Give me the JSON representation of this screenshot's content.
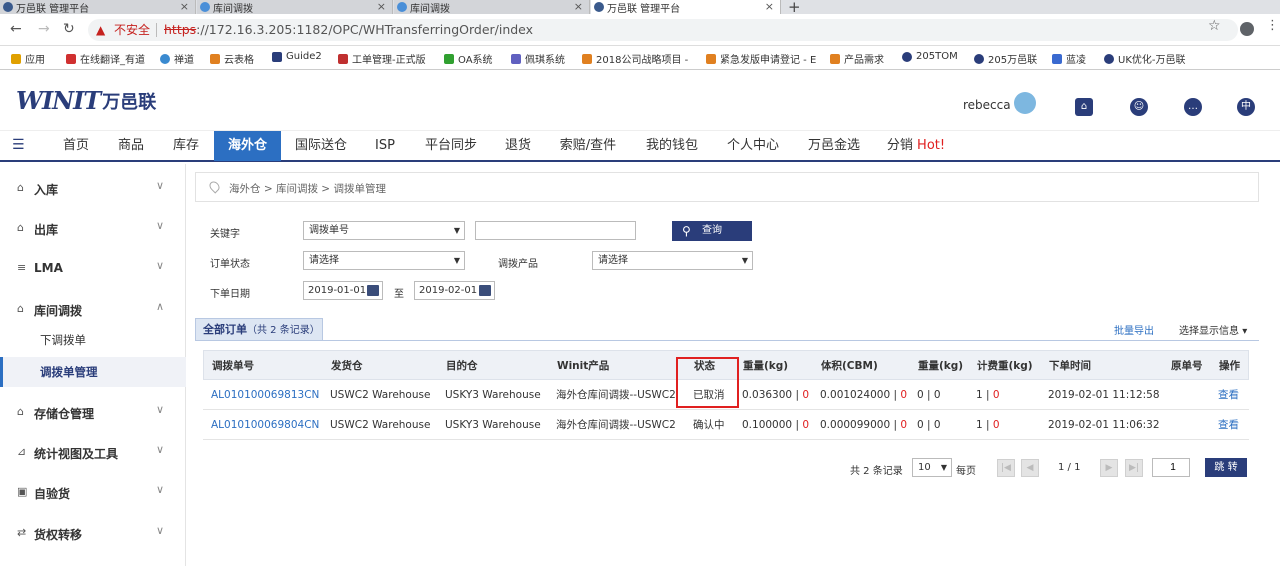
{
  "browser": {
    "tabs": [
      {
        "label": "万邑联 管理平台",
        "active": false
      },
      {
        "label": "库间调拨",
        "active": false
      },
      {
        "label": "库间调拨",
        "active": false
      },
      {
        "label": "万邑联 管理平台",
        "active": true
      }
    ],
    "insecure_label": "不安全",
    "url_scheme": "https",
    "url_rest": "://172.16.3.205:1182/OPC/WHTransferringOrder/index",
    "bookmarks": [
      "应用",
      "在线翻译_有道",
      "禅道",
      "云表格",
      "Guide2",
      "工单管理-正式版",
      "OA系统",
      "佩琪系统",
      "2018公司战略项目 -",
      "紧急发版申请登记 - E",
      "产品需求",
      "205TOM",
      "205万邑联",
      "蓝凌",
      "UK优化-万邑联"
    ]
  },
  "header": {
    "logo_mark": "WINIT",
    "logo_text": "万邑联",
    "username": "rebecca",
    "lang": "中"
  },
  "nav": {
    "items": [
      "首页",
      "商品",
      "库存",
      "海外仓",
      "国际送仓",
      "ISP",
      "平台同步",
      "退货",
      "索赔/查件",
      "我的钱包",
      "个人中心",
      "万邑金选",
      "分销"
    ],
    "hot": "Hot!",
    "active": "海外仓"
  },
  "sidebar": {
    "groups": [
      {
        "label": "入库",
        "icon": "inbound-icon"
      },
      {
        "label": "出库",
        "icon": "outbound-icon"
      },
      {
        "label": "LMA",
        "icon": "lma-icon"
      },
      {
        "label": "库间调拨",
        "icon": "transfer-icon"
      },
      {
        "label": "存储仓管理",
        "icon": "storage-icon"
      },
      {
        "label": "统计视图及工具",
        "icon": "chart-icon"
      },
      {
        "label": "自验货",
        "icon": "inspect-icon"
      },
      {
        "label": "货权转移",
        "icon": "ownership-icon"
      }
    ],
    "sub_items": [
      "下调拨单",
      "调拨单管理"
    ],
    "active_sub": "调拨单管理"
  },
  "breadcrumb": "海外仓 > 库间调拨 > 调拨单管理",
  "filters": {
    "keyword_label": "关键字",
    "keyword_type": "调拨单号",
    "keyword_value": "",
    "query_button": "查询",
    "status_label": "订单状态",
    "status_value": "请选择",
    "product_label": "调拨产品",
    "product_value": "请选择",
    "date_label": "下单日期",
    "date_from": "2019-01-01",
    "date_to_label": "至",
    "date_to": "2019-02-01"
  },
  "list": {
    "tab_label": "全部订单",
    "tab_count": "（共 2 条记录）",
    "export": "批量导出",
    "show_info": "选择显示信息",
    "columns": [
      "调拨单号",
      "发货仓",
      "目的仓",
      "Winit产品",
      "状态",
      "重量(kg)",
      "体积(CBM)",
      "重量(kg)",
      "计费重(kg)",
      "下单时间",
      "原单号",
      "操作"
    ],
    "rows": [
      {
        "order_no": "AL010100069813CN",
        "from": "USWC2 Warehouse",
        "to": "USKY3 Warehouse",
        "product": "海外仓库间调拨--USWC2",
        "status": "已取消",
        "weight": "0.036300",
        "weight_r": "0",
        "volume": "0.001024000",
        "volume_r": "0",
        "weight2": "0",
        "weight2_r": "0",
        "charge": "1",
        "charge_r": "0",
        "time": "2019-02-01 11:12:58",
        "orig": "",
        "action": "查看"
      },
      {
        "order_no": "AL010100069804CN",
        "from": "USWC2 Warehouse",
        "to": "USKY3 Warehouse",
        "product": "海外仓库间调拨--USWC2",
        "status": "确认中",
        "weight": "0.100000",
        "weight_r": "0",
        "volume": "0.000099000",
        "volume_r": "0",
        "weight2": "0",
        "weight2_r": "0",
        "charge": "1",
        "charge_r": "0",
        "time": "2019-02-01 11:06:32",
        "orig": "",
        "action": "查看"
      }
    ]
  },
  "pager": {
    "total": "共 2 条记录",
    "page_size": "10",
    "per_page": "每页",
    "page_info": "1 / 1",
    "page_input": "1",
    "jump": "跳 转"
  }
}
